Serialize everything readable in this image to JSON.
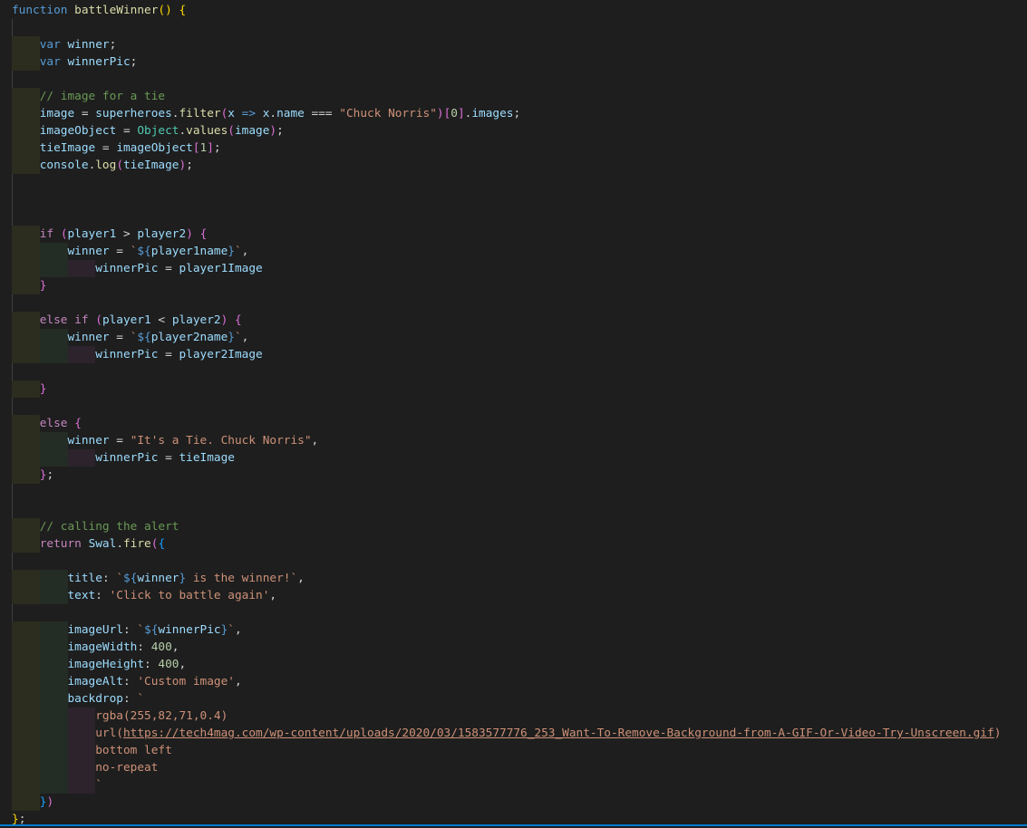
{
  "editor": {
    "language": "javascript",
    "theme_colors": {
      "background": "#1e1e1e",
      "keyword": "#569cd6",
      "control": "#c586c0",
      "function": "#dcdcaa",
      "variable": "#9cdcfe",
      "string": "#ce9178",
      "comment": "#6a9955",
      "number": "#b5cea8",
      "class": "#4ec9b0",
      "status_bar": "#007acc"
    },
    "lines": [
      [
        [
          "function ",
          "kw"
        ],
        [
          "battleWinner",
          "fn"
        ],
        [
          "() ",
          "b1"
        ],
        [
          "{",
          "b1"
        ]
      ],
      [],
      [
        [
          "    "
        ],
        [
          "var ",
          "kw"
        ],
        [
          "winner",
          "var"
        ],
        [
          ";",
          "pl"
        ]
      ],
      [
        [
          "    "
        ],
        [
          "var ",
          "kw"
        ],
        [
          "winnerPic",
          "var"
        ],
        [
          ";",
          "pl"
        ]
      ],
      [],
      [
        [
          "    "
        ],
        [
          "// image for a tie",
          "cm"
        ]
      ],
      [
        [
          "    "
        ],
        [
          "image",
          "var"
        ],
        [
          " = ",
          "pl"
        ],
        [
          "superheroes",
          "var"
        ],
        [
          ".",
          "pl"
        ],
        [
          "filter",
          "fn"
        ],
        [
          "(",
          "b2"
        ],
        [
          "x",
          "var"
        ],
        [
          " => ",
          "kw"
        ],
        [
          "x",
          "var"
        ],
        [
          ".",
          "pl"
        ],
        [
          "name",
          "var"
        ],
        [
          " === ",
          "pl"
        ],
        [
          "\"Chuck Norris\"",
          "str"
        ],
        [
          ")",
          "b2"
        ],
        [
          "[",
          "b2"
        ],
        [
          "0",
          "num"
        ],
        [
          "]",
          "b2"
        ],
        [
          ".",
          "pl"
        ],
        [
          "images",
          "var"
        ],
        [
          ";",
          "pl"
        ]
      ],
      [
        [
          "    "
        ],
        [
          "imageObject",
          "var"
        ],
        [
          " = ",
          "pl"
        ],
        [
          "Object",
          "cls"
        ],
        [
          ".",
          "pl"
        ],
        [
          "values",
          "fn"
        ],
        [
          "(",
          "b2"
        ],
        [
          "image",
          "var"
        ],
        [
          ")",
          "b2"
        ],
        [
          ";",
          "pl"
        ]
      ],
      [
        [
          "    "
        ],
        [
          "tieImage",
          "var"
        ],
        [
          " = ",
          "pl"
        ],
        [
          "imageObject",
          "var"
        ],
        [
          "[",
          "b2"
        ],
        [
          "1",
          "num"
        ],
        [
          "]",
          "b2"
        ],
        [
          ";",
          "pl"
        ]
      ],
      [
        [
          "    "
        ],
        [
          "console",
          "var"
        ],
        [
          ".",
          "pl"
        ],
        [
          "log",
          "fn"
        ],
        [
          "(",
          "b2"
        ],
        [
          "tieImage",
          "var"
        ],
        [
          ")",
          "b2"
        ],
        [
          ";",
          "pl"
        ]
      ],
      [],
      [],
      [],
      [
        [
          "    "
        ],
        [
          "if ",
          "ctl"
        ],
        [
          "(",
          "b2"
        ],
        [
          "player1",
          "var"
        ],
        [
          " > ",
          "pl"
        ],
        [
          "player2",
          "var"
        ],
        [
          ") ",
          "b2"
        ],
        [
          "{",
          "b2"
        ]
      ],
      [
        [
          "        "
        ],
        [
          "winner",
          "var"
        ],
        [
          " = ",
          "pl"
        ],
        [
          "`",
          "str"
        ],
        [
          "${",
          "tp"
        ],
        [
          "player1name",
          "var"
        ],
        [
          "}",
          "tp"
        ],
        [
          "`",
          "str"
        ],
        [
          ",",
          "pl"
        ]
      ],
      [
        [
          "            "
        ],
        [
          "winnerPic",
          "var"
        ],
        [
          " = ",
          "pl"
        ],
        [
          "player1Image",
          "var"
        ]
      ],
      [
        [
          "    "
        ],
        [
          "}",
          "b2"
        ]
      ],
      [],
      [
        [
          "    "
        ],
        [
          "else if ",
          "ctl"
        ],
        [
          "(",
          "b2"
        ],
        [
          "player1",
          "var"
        ],
        [
          " < ",
          "pl"
        ],
        [
          "player2",
          "var"
        ],
        [
          ") ",
          "b2"
        ],
        [
          "{",
          "b2"
        ]
      ],
      [
        [
          "        "
        ],
        [
          "winner",
          "var"
        ],
        [
          " = ",
          "pl"
        ],
        [
          "`",
          "str"
        ],
        [
          "${",
          "tp"
        ],
        [
          "player2name",
          "var"
        ],
        [
          "}",
          "tp"
        ],
        [
          "`",
          "str"
        ],
        [
          ",",
          "pl"
        ]
      ],
      [
        [
          "            "
        ],
        [
          "winnerPic",
          "var"
        ],
        [
          " = ",
          "pl"
        ],
        [
          "player2Image",
          "var"
        ]
      ],
      [],
      [
        [
          "    "
        ],
        [
          "}",
          "b2"
        ]
      ],
      [],
      [
        [
          "    "
        ],
        [
          "else ",
          "ctl"
        ],
        [
          "{",
          "b2"
        ]
      ],
      [
        [
          "        "
        ],
        [
          "winner",
          "var"
        ],
        [
          " = ",
          "pl"
        ],
        [
          "\"It's a Tie. Chuck Norris\"",
          "str"
        ],
        [
          ",",
          "pl"
        ]
      ],
      [
        [
          "            "
        ],
        [
          "winnerPic",
          "var"
        ],
        [
          " = ",
          "pl"
        ],
        [
          "tieImage",
          "var"
        ]
      ],
      [
        [
          "    "
        ],
        [
          "}",
          "b2"
        ],
        [
          ";",
          "pl"
        ]
      ],
      [],
      [],
      [
        [
          "    "
        ],
        [
          "// calling the alert",
          "cm"
        ]
      ],
      [
        [
          "    "
        ],
        [
          "return ",
          "ctl"
        ],
        [
          "Swal",
          "var"
        ],
        [
          ".",
          "pl"
        ],
        [
          "fire",
          "fn"
        ],
        [
          "(",
          "b2"
        ],
        [
          "{",
          "b3"
        ]
      ],
      [],
      [
        [
          "        "
        ],
        [
          "title",
          "var"
        ],
        [
          ": ",
          "pl"
        ],
        [
          "`",
          "str"
        ],
        [
          "${",
          "tp"
        ],
        [
          "winner",
          "var"
        ],
        [
          "}",
          "tp"
        ],
        [
          " is the winner!`",
          "str"
        ],
        [
          ",",
          "pl"
        ]
      ],
      [
        [
          "        "
        ],
        [
          "text",
          "var"
        ],
        [
          ": ",
          "pl"
        ],
        [
          "'Click to battle again'",
          "str"
        ],
        [
          ",",
          "pl"
        ]
      ],
      [],
      [
        [
          "        "
        ],
        [
          "imageUrl",
          "var"
        ],
        [
          ": ",
          "pl"
        ],
        [
          "`",
          "str"
        ],
        [
          "${",
          "tp"
        ],
        [
          "winnerPic",
          "var"
        ],
        [
          "}",
          "tp"
        ],
        [
          "`",
          "str"
        ],
        [
          ",",
          "pl"
        ]
      ],
      [
        [
          "        "
        ],
        [
          "imageWidth",
          "var"
        ],
        [
          ": ",
          "pl"
        ],
        [
          "400",
          "num"
        ],
        [
          ",",
          "pl"
        ]
      ],
      [
        [
          "        "
        ],
        [
          "imageHeight",
          "var"
        ],
        [
          ": ",
          "pl"
        ],
        [
          "400",
          "num"
        ],
        [
          ",",
          "pl"
        ]
      ],
      [
        [
          "        "
        ],
        [
          "imageAlt",
          "var"
        ],
        [
          ": ",
          "pl"
        ],
        [
          "'Custom image'",
          "str"
        ],
        [
          ",",
          "pl"
        ]
      ],
      [
        [
          "        "
        ],
        [
          "backdrop",
          "var"
        ],
        [
          ": ",
          "pl"
        ],
        [
          "`",
          "str"
        ]
      ],
      [
        [
          "            "
        ],
        [
          "rgba(255,82,71,0.4)",
          "str"
        ]
      ],
      [
        [
          "            "
        ],
        [
          "url(",
          "str"
        ],
        [
          "https://tech4mag.com/wp-content/uploads/2020/03/1583577776_253_Want-To-Remove-Background-from-A-GIF-Or-Video-Try-Unscreen.gif",
          "link"
        ],
        [
          ")",
          "str"
        ]
      ],
      [
        [
          "            "
        ],
        [
          "bottom left",
          "str"
        ]
      ],
      [
        [
          "            "
        ],
        [
          "no-repeat",
          "str"
        ]
      ],
      [
        [
          "            "
        ],
        [
          "`",
          "str"
        ]
      ],
      [
        [
          "    "
        ],
        [
          "}",
          "b3"
        ],
        [
          ")",
          "b2"
        ]
      ],
      [
        [
          "}",
          "b1"
        ],
        [
          ";",
          "pl"
        ]
      ]
    ]
  }
}
